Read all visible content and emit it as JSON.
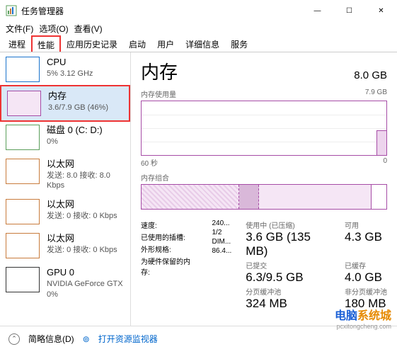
{
  "window": {
    "title": "任务管理器",
    "minimize": "—",
    "maximize": "☐",
    "close": "✕"
  },
  "menus": [
    "文件(F)",
    "选项(O)",
    "查看(V)"
  ],
  "tabs": [
    "进程",
    "性能",
    "应用历史记录",
    "启动",
    "用户",
    "详细信息",
    "服务"
  ],
  "sidebar": [
    {
      "title": "CPU",
      "sub": "5% 3.12 GHz"
    },
    {
      "title": "内存",
      "sub": "3.6/7.9 GB (46%)"
    },
    {
      "title": "磁盘 0 (C: D:)",
      "sub": "0%"
    },
    {
      "title": "以太网",
      "sub": "发送: 8.0 接收: 8.0 Kbps"
    },
    {
      "title": "以太网",
      "sub": "发送: 0 接收: 0 Kbps"
    },
    {
      "title": "以太网",
      "sub": "发送: 0 接收: 0 Kbps"
    },
    {
      "title": "GPU 0",
      "sub": "NVIDIA GeForce GTX",
      "sub2": "0%"
    }
  ],
  "main": {
    "title": "内存",
    "total": "8.0 GB",
    "usage_label": "内存使用量",
    "usage_max": "7.9 GB",
    "axis_left": "60 秒",
    "axis_right": "0",
    "comp_label": "内存组合",
    "stats": {
      "inuse_label": "使用中 (已压缩)",
      "inuse_value": "3.6 GB (135 MB)",
      "avail_label": "可用",
      "avail_value": "4.3 GB",
      "commit_label": "已提交",
      "commit_value": "6.3/9.5 GB",
      "cached_label": "已缓存",
      "cached_value": "4.0 GB",
      "paged_label": "分页缓冲池",
      "paged_value": "324 MB",
      "nonpaged_label": "非分页缓冲池",
      "nonpaged_value": "180 MB"
    },
    "right": {
      "speed_label": "速度:",
      "speed_value": "240...",
      "slots_label": "已使用的插槽:",
      "slots_value": "1/2",
      "form_label": "外形规格:",
      "form_value": "DIM...",
      "reserved_label": "为硬件保留的内存:",
      "reserved_value": "86.4..."
    }
  },
  "footer": {
    "less": "简略信息(D)",
    "monitor": "打开资源监视器"
  },
  "watermark": {
    "blue": "电脑",
    "orange": "系统城",
    "url": "pcxitongcheng.com"
  }
}
